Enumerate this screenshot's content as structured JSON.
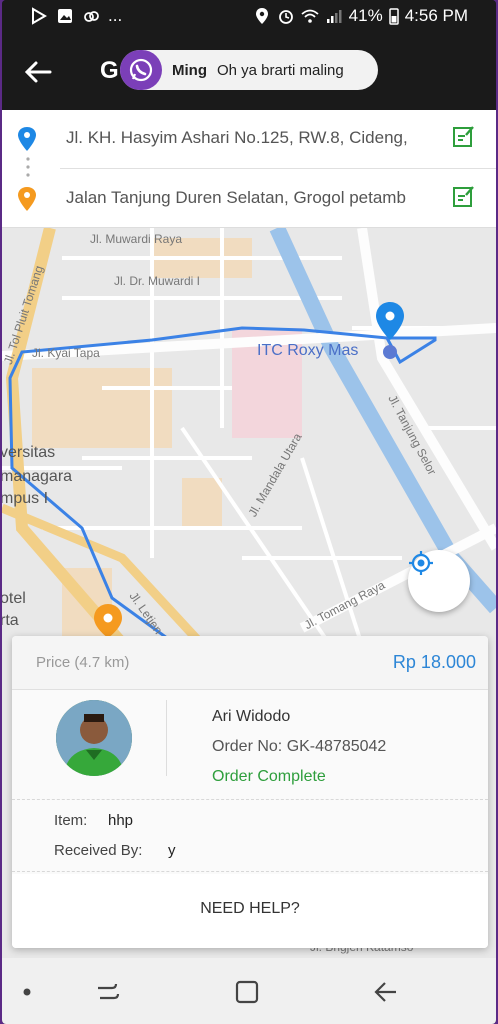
{
  "status_bar": {
    "battery": "41%",
    "time": "4:56 PM",
    "overflow": "..."
  },
  "app_bar": {
    "title": "G"
  },
  "notification": {
    "sender": "Ming",
    "message": "Oh ya brarti maling",
    "icon": "whatsapp-icon"
  },
  "route": {
    "pickup": "Jl. KH. Hasyim Ashari No.125, RW.8, Cideng,",
    "destination": "Jalan Tanjung Duren Selatan, Grogol petamb"
  },
  "map": {
    "labels": [
      "Jl. Muwardi Raya",
      "Jl. Dr. Muwardi I",
      "Jl. Kyai Tapa",
      "Jl. Tol Pluit Tomang",
      "ITC Roxy Mas",
      "Jl. Tanjung Selor",
      "versitas",
      "managara",
      "mpus I",
      "Jl. Mandala Utara",
      "otel",
      "rta",
      "Jl. Letjen",
      "Jl. Tomang Raya",
      "Jl. Brigjen Katamso"
    ],
    "colors": {
      "route": "#3b82e6",
      "pickup_pin": "#1e88e5",
      "destination_pin": "#f59a1f"
    }
  },
  "order": {
    "price_label": "Price (4.7 km)",
    "price_value": "Rp 18.000",
    "driver_name": "Ari Widodo",
    "order_no": "Order No: GK-48785042",
    "status": "Order Complete",
    "item_label": "Item:",
    "item_value": "hhp",
    "received_label": "Received By:",
    "received_value": "y",
    "help": "NEED HELP?"
  }
}
